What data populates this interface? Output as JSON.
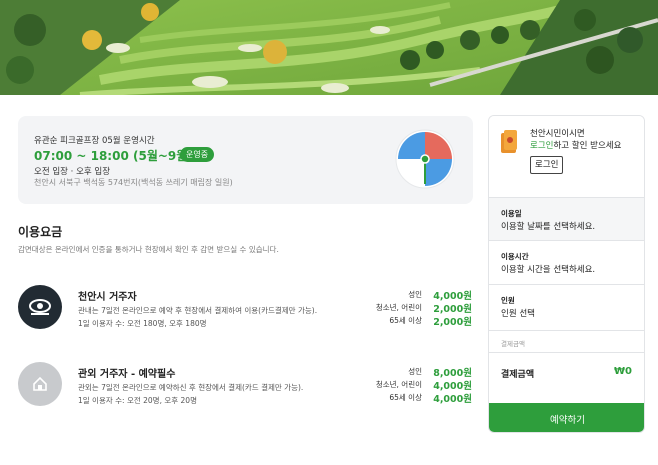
{
  "info": {
    "title": "유관순 피크골프장 05월 운영시간",
    "hours": "07:00 ~ 18:00 (5월~9월)",
    "status_badge": "운영중",
    "entry": "오전 입장 · 오후 입장",
    "address": "천안시 서북구 백석동 574번지(백석동 쓰레기 매립장 일원)"
  },
  "fees": {
    "title": "이용요금",
    "description": "감면대상은 온라인에서 인증을 통하거나 현장에서 확인 후 감면 받으실 수 있습니다.",
    "rows": [
      {
        "name": "천안시 거주자",
        "desc": "관내는 7일전 온라인으로 예약 후 현장에서 결제하여 이용(카드결제만 가능).",
        "count": "1일 이용자 수: 오전 180명, 오후 180명",
        "icon": "resident-icon",
        "prices": [
          {
            "label": "성인",
            "value": "4,000원"
          },
          {
            "label": "청소년, 어린이",
            "value": "2,000원"
          },
          {
            "label": "65세 이상",
            "value": "2,000원"
          }
        ]
      },
      {
        "name": "관외 거주자 - 예약필수",
        "desc": "관외는 7일전 온라인으로 예약하신 후 현장에서 결제(카드 결제만 가능).",
        "count": "1일 이용자 수: 오전 20명, 오후 20명",
        "icon": "home-icon",
        "prices": [
          {
            "label": "성인",
            "value": "8,000원"
          },
          {
            "label": "청소년, 어린이",
            "value": "4,000원"
          },
          {
            "label": "65세 이상",
            "value": "4,000원"
          }
        ]
      }
    ]
  },
  "sidebar": {
    "citizen_line1": "천안시민이시면",
    "citizen_login_link": "로그인",
    "citizen_line2_rest": "하고 할인 받으세요",
    "login_button": "로그인",
    "date_label": "이용일",
    "date_value": "이용할 날짜를 선택하세요.",
    "time_label": "이용시간",
    "time_value": "이용할 시간을 선택하세요.",
    "people_label": "인원",
    "people_value": "인원 선택",
    "calc_label": "결제금액",
    "total_label": "결제금액",
    "total_value": "₩0",
    "reserve_button": "예약하기"
  },
  "colors": {
    "accent": "#2e9e3c",
    "dark_icon_bg": "#222b33",
    "gray_icon_bg": "#c8cacd"
  }
}
